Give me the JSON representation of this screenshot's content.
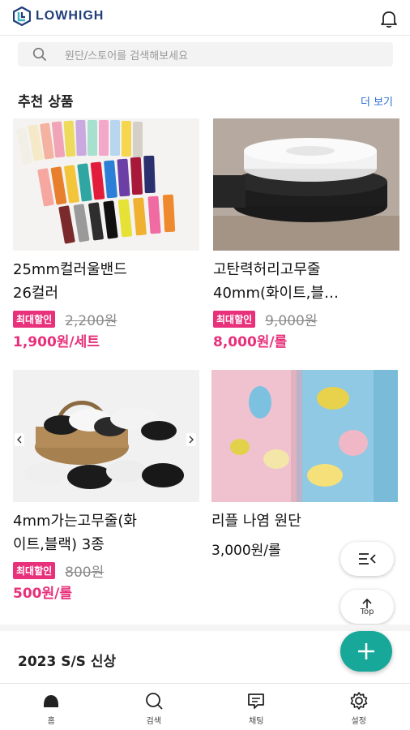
{
  "header": {
    "brand": "LOWHIGH",
    "brand_color": "#1f3d7a",
    "bell_icon": "bell-icon",
    "logo_icon": "lowhigh-logo"
  },
  "search": {
    "placeholder": "원단/스토어를 검색해보세요",
    "icon": "search-icon"
  },
  "recommended": {
    "title": "추천 상품",
    "more_label": "더 보기",
    "products": [
      {
        "name_line1": "25mm컬러울밴드",
        "name_line2": "26컬러",
        "badge": "최대할인",
        "original_price": "2,200원",
        "price": "1,900원/세트"
      },
      {
        "name_line1": "고탄력허리고무줄",
        "name_line2": "40mm(화이트,블…",
        "badge": "최대할인",
        "original_price": "9,000원",
        "price": "8,000원/롤"
      },
      {
        "name_line1": "4mm가는고무줄(화",
        "name_line2": "이트,블랙) 3종",
        "badge": "최대할인",
        "original_price": "800원",
        "price": "500원/롤"
      },
      {
        "name_line1": "리플 나염 원단",
        "price": "3,000원/롤"
      }
    ]
  },
  "floating": {
    "top_label": "Top"
  },
  "new_section": {
    "title": "2023 S/S 신상"
  },
  "bottom_nav": [
    {
      "label": "홈",
      "icon": "home-icon"
    },
    {
      "label": "검색",
      "icon": "search-icon"
    },
    {
      "label": "채팅",
      "icon": "chat-icon"
    },
    {
      "label": "설정",
      "icon": "gear-icon"
    }
  ],
  "colors": {
    "accent_pink": "#e8307b",
    "link_blue": "#2b6fd6",
    "fab_teal": "#18a89a"
  }
}
